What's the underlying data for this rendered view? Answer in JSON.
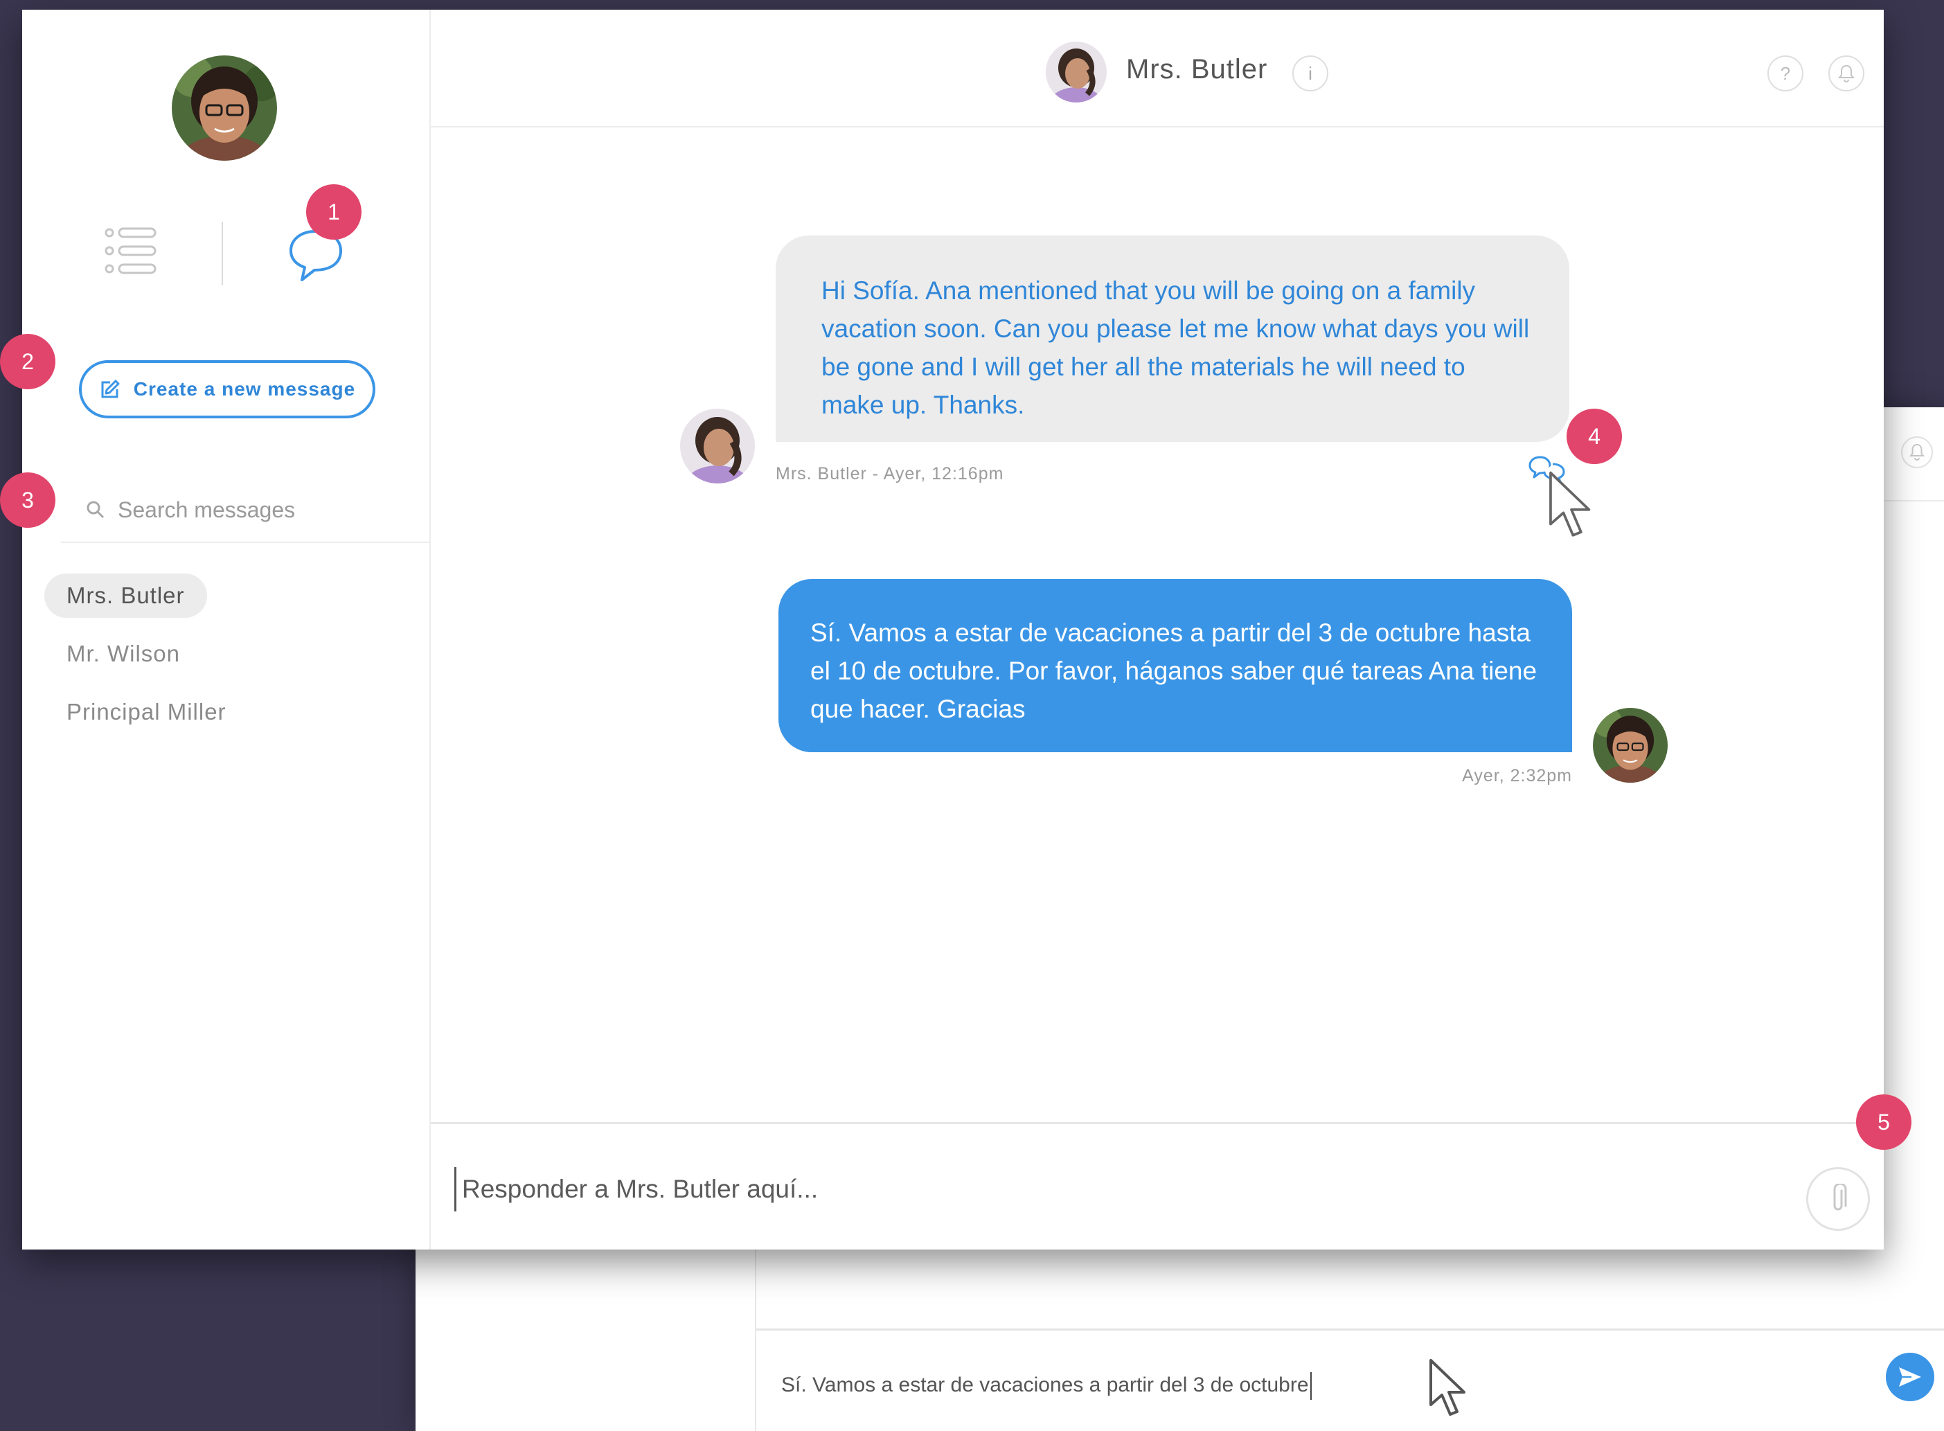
{
  "sidebar": {
    "create_button_label": "Create a new message",
    "search_placeholder": "Search messages",
    "contacts": [
      {
        "name": "Mrs. Butler",
        "selected": true
      },
      {
        "name": "Mr. Wilson",
        "selected": false
      },
      {
        "name": "Principal Miller",
        "selected": false
      }
    ]
  },
  "header": {
    "contact_name": "Mrs. Butler",
    "info_icon": "i",
    "help_icon": "?"
  },
  "messages": [
    {
      "direction": "incoming",
      "text": "Hi Sofía. Ana mentioned that you will be going on a family vacation soon. Can you please let me know what days you will be gone and I will get her all the materials he will need to make up. Thanks.",
      "meta": "Mrs. Butler - Ayer, 12:16pm"
    },
    {
      "direction": "outgoing",
      "text": "Sí. Vamos a estar de vacaciones a partir del 3 de octubre hasta el 10 de octubre. Por favor, háganos saber qué tareas Ana tiene que hacer. Gracias",
      "meta": "Ayer, 2:32pm"
    }
  ],
  "composer": {
    "placeholder": "Responder a Mrs. Butler aquí..."
  },
  "background_window": {
    "composer_text": "Sí. Vamos a estar de vacaciones a partir del 3 de octubre"
  },
  "annotations": [
    "1",
    "2",
    "3",
    "4",
    "5"
  ],
  "icons": {
    "list_view": "list-icon",
    "chat_view": "chat-bubble-icon",
    "edit": "edit-icon",
    "search": "search-icon",
    "info": "info-icon",
    "help": "help-icon",
    "bell": "bell-icon",
    "translate": "translate-icon",
    "attach": "paperclip-icon",
    "send": "send-icon"
  },
  "colors": {
    "accent": "#3a95e6",
    "accent_text": "#2f86d8",
    "badge": "#e2456b",
    "background": "#3a3650",
    "incoming_bubble": "#ececec"
  }
}
